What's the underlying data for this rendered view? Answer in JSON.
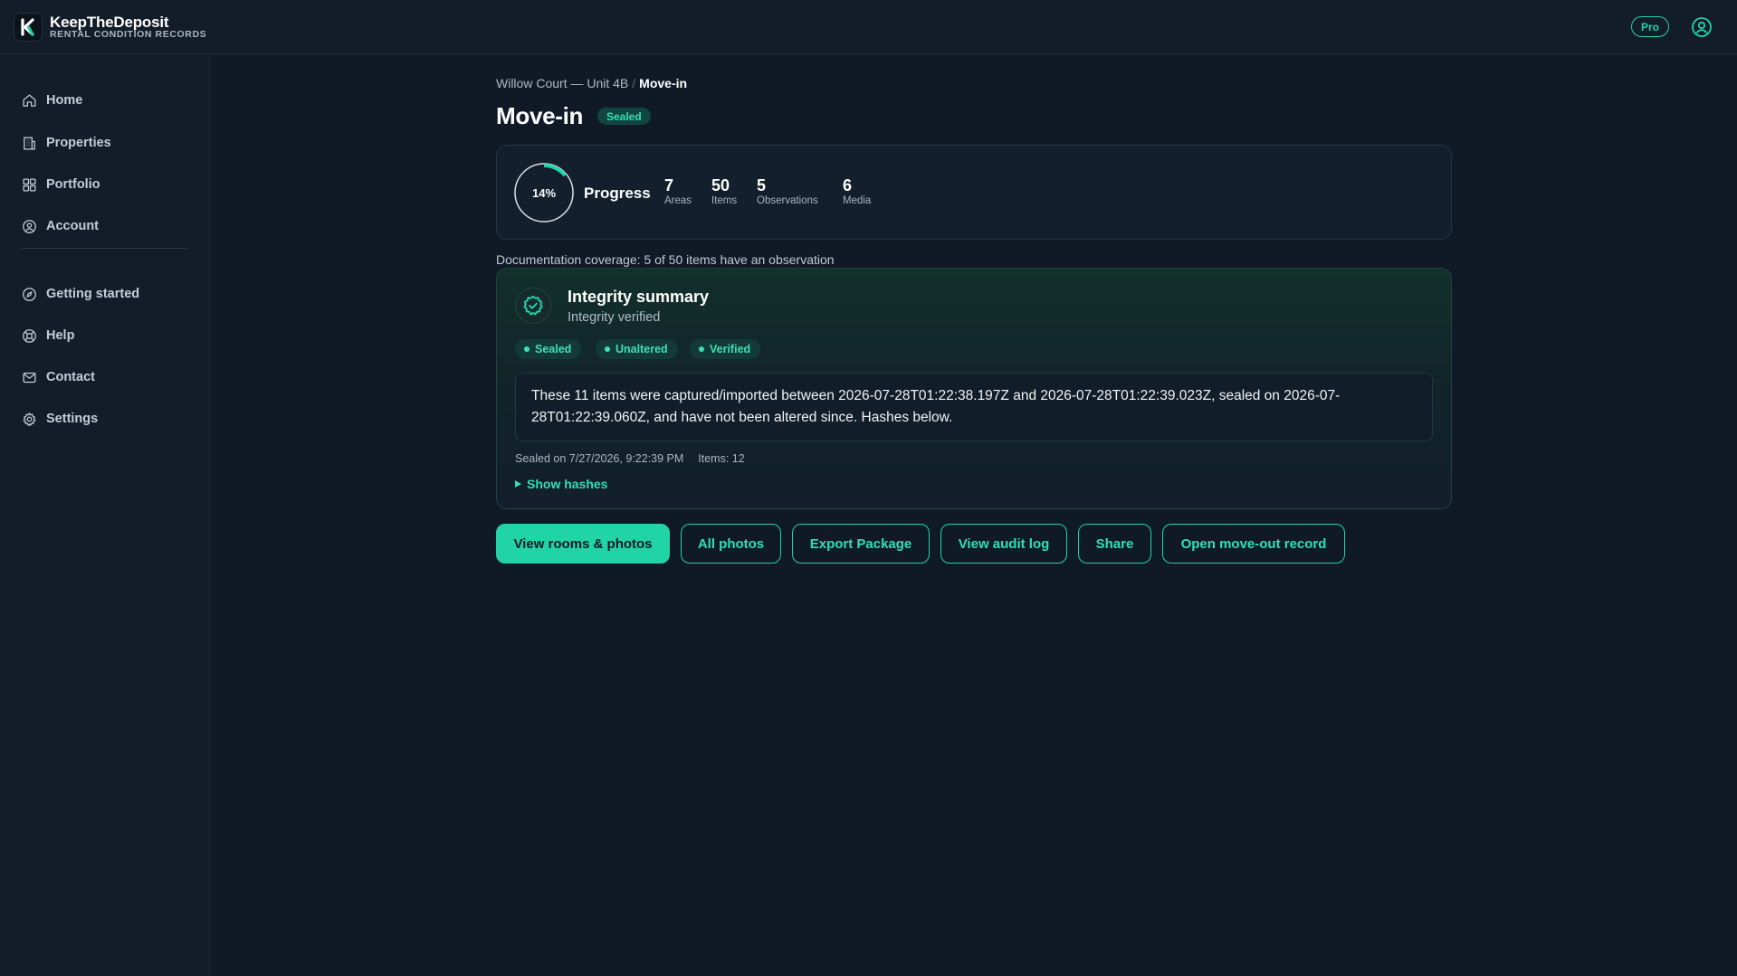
{
  "brand": {
    "name": "KeepTheDeposit",
    "subtitle": "RENTAL CONDITION RECORDS",
    "logo_letter": "K"
  },
  "header": {
    "plan_badge": "Pro",
    "account_icon": "user-circle-icon"
  },
  "sidebar": {
    "items": [
      {
        "label": "Home",
        "icon": "home-icon"
      },
      {
        "label": "Properties",
        "icon": "building-icon"
      },
      {
        "label": "Portfolio",
        "icon": "grid-icon"
      },
      {
        "label": "Account",
        "icon": "user-circle-icon"
      }
    ],
    "secondary_items": [
      {
        "label": "Getting started",
        "icon": "compass-icon"
      },
      {
        "label": "Help",
        "icon": "lifebuoy-icon"
      },
      {
        "label": "Contact",
        "icon": "mail-icon"
      },
      {
        "label": "Settings",
        "icon": "gear-icon"
      }
    ]
  },
  "breadcrumb": {
    "parent": "Willow Court — Unit 4B",
    "separator": "/",
    "current": "Move-in"
  },
  "page": {
    "title": "Move-in",
    "status_badge": "Sealed"
  },
  "progress": {
    "percent_label": "14%",
    "percent": 14,
    "label": "Progress",
    "stats": [
      {
        "value": "7",
        "label": "Areas"
      },
      {
        "value": "50",
        "label": "Items"
      },
      {
        "value": "5",
        "label": "Observations"
      },
      {
        "value": "6",
        "label": "Media"
      }
    ]
  },
  "coverage_text": "Documentation coverage: 5 of 50 items have an observation",
  "integrity": {
    "title": "Integrity summary",
    "subtitle": "Integrity verified",
    "chips": [
      "Sealed",
      "Unaltered",
      "Verified"
    ],
    "statement": "These 11 items were captured/imported between 2026-07-28T01:22:38.197Z and 2026-07-28T01:22:39.023Z, sealed on 2026-07-28T01:22:39.060Z, and have not been altered since. Hashes below.",
    "sealed_on": "Sealed on 7/27/2026, 9:22:39 PM",
    "items_count": "Items: 12",
    "show_hashes": "Show hashes"
  },
  "actions": [
    "View rooms & photos",
    "All photos",
    "Export Package",
    "View audit log",
    "Share",
    "Open move-out record"
  ],
  "colors": {
    "accent": "#20d4a6",
    "background": "#0f1a26",
    "panel": "#121d29"
  }
}
